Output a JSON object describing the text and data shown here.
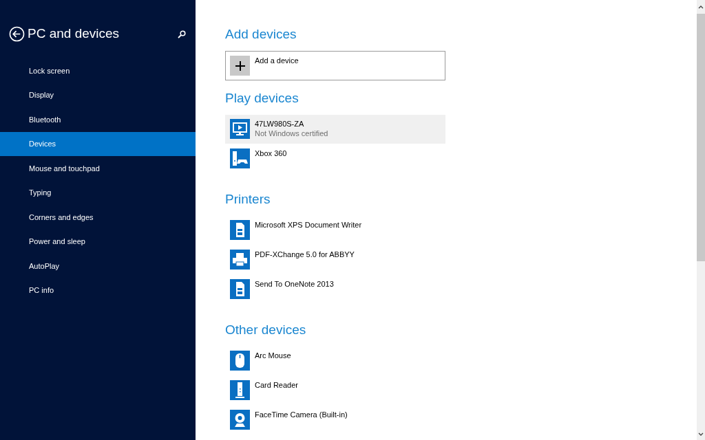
{
  "sidebar": {
    "title": "PC and devices",
    "items": [
      {
        "label": "Lock screen",
        "selected": false
      },
      {
        "label": "Display",
        "selected": false
      },
      {
        "label": "Bluetooth",
        "selected": false
      },
      {
        "label": "Devices",
        "selected": true
      },
      {
        "label": "Mouse and touchpad",
        "selected": false
      },
      {
        "label": "Typing",
        "selected": false
      },
      {
        "label": "Corners and edges",
        "selected": false
      },
      {
        "label": "Power and sleep",
        "selected": false
      },
      {
        "label": "AutoPlay",
        "selected": false
      },
      {
        "label": "PC info",
        "selected": false
      }
    ]
  },
  "add_devices": {
    "heading": "Add devices",
    "button_label": "Add a device"
  },
  "sections": [
    {
      "heading": "Play devices",
      "devices": [
        {
          "name": "47LW980S-ZA",
          "status": "Not Windows certified",
          "kind": "display",
          "selected": true
        },
        {
          "name": "Xbox 360",
          "kind": "console",
          "selected": false
        }
      ]
    },
    {
      "heading": "Printers",
      "devices": [
        {
          "name": "Microsoft XPS Document Writer",
          "kind": "document-printer",
          "selected": false
        },
        {
          "name": "PDF-XChange 5.0 for ABBYY",
          "kind": "printer",
          "selected": false
        },
        {
          "name": "Send To OneNote 2013",
          "kind": "document-printer",
          "selected": false
        }
      ]
    },
    {
      "heading": "Other devices",
      "devices": [
        {
          "name": "Arc Mouse",
          "kind": "mouse",
          "selected": false
        },
        {
          "name": "Card Reader",
          "kind": "card-reader",
          "selected": false
        },
        {
          "name": "FaceTime Camera (Built-in)",
          "kind": "camera",
          "selected": false
        }
      ]
    }
  ]
}
